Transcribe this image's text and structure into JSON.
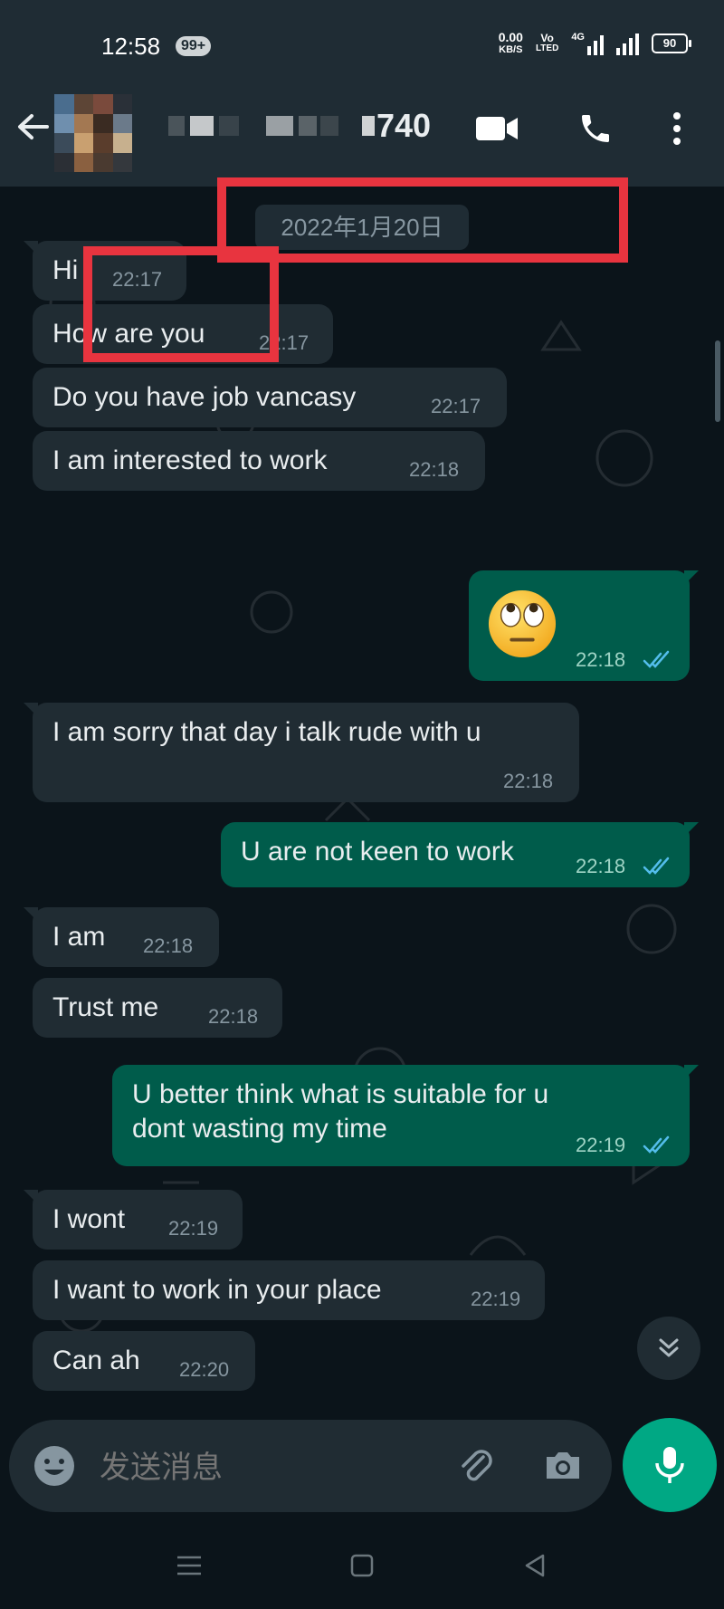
{
  "status_bar": {
    "time": "12:58",
    "notification_badge": "99+",
    "net_speed_value": "0.00",
    "net_speed_unit": "KB/S",
    "volte_top": "Vo",
    "volte_bottom": "LTED",
    "network": "4G",
    "battery": "90"
  },
  "header": {
    "contact_name_visible": "740",
    "icons": [
      "back-arrow-icon",
      "video-call-icon",
      "phone-icon",
      "more-vert-icon"
    ]
  },
  "chat": {
    "date": "2022年1月20日",
    "messages": [
      {
        "dir": "in",
        "text": "Hi",
        "time": "22:17"
      },
      {
        "dir": "in",
        "text": "How are you",
        "time": "22:17"
      },
      {
        "dir": "in",
        "text": "Do you have job vancasy",
        "time": "22:17"
      },
      {
        "dir": "in",
        "text": "I am interested to work",
        "time": "22:18"
      },
      {
        "dir": "out",
        "text": "",
        "emoji": "face-with-rolling-eyes",
        "time": "22:18",
        "read": true
      },
      {
        "dir": "in",
        "text": "I am sorry that day i talk rude with u",
        "time": "22:18"
      },
      {
        "dir": "out",
        "text": "U are not keen to work",
        "time": "22:18",
        "read": true
      },
      {
        "dir": "in",
        "text": "I am",
        "time": "22:18"
      },
      {
        "dir": "in",
        "text": "Trust me",
        "time": "22:18"
      },
      {
        "dir": "out",
        "text_line1": "U better think what is suitable for u",
        "text_line2": "dont wasting my time",
        "time": "22:19",
        "read": true
      },
      {
        "dir": "in",
        "text": "I wont",
        "time": "22:19"
      },
      {
        "dir": "in",
        "text": "I want to work in your place",
        "time": "22:19"
      },
      {
        "dir": "in",
        "text": "Can ah",
        "time": "22:20"
      }
    ]
  },
  "composer": {
    "placeholder": "发送消息"
  },
  "colors": {
    "header_bg": "#1f2c34",
    "chat_bg": "#0b141a",
    "incoming_bubble": "#202c33",
    "outgoing_bubble": "#005c4b",
    "accent": "#00a884",
    "read_ticks": "#53bdeb",
    "annotation_red": "#e8343f"
  }
}
